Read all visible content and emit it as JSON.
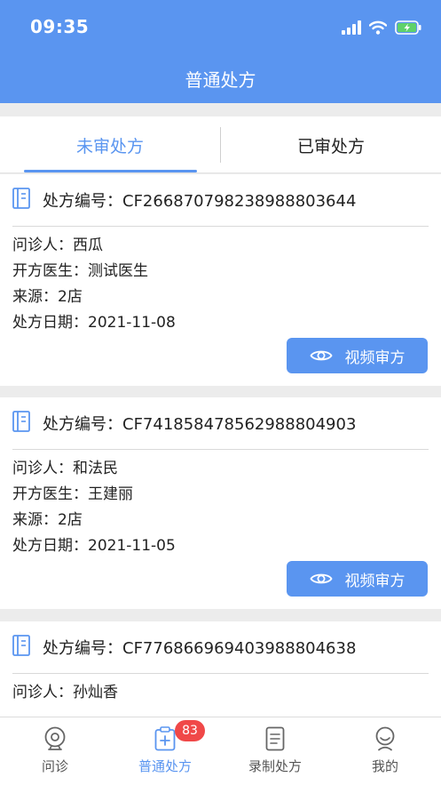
{
  "status_bar": {
    "time": "09:35"
  },
  "header": {
    "title": "普通处方"
  },
  "tabs": [
    {
      "label": "未审处方",
      "active": true
    },
    {
      "label": "已审处方",
      "active": false
    }
  ],
  "prescriptions": [
    {
      "number_label": "处方编号：CF266870798238988803644",
      "patient": "问诊人：西瓜",
      "doctor": "开方医生：测试医生",
      "source": "来源：2店",
      "date": "处方日期：2021-11-08",
      "button_label": "视频审方"
    },
    {
      "number_label": "处方编号：CF741858478562988804903",
      "patient": "问诊人：和法民",
      "doctor": "开方医生：王建丽",
      "source": "来源：2店",
      "date": "处方日期：2021-11-05",
      "button_label": "视频审方"
    },
    {
      "number_label": "处方编号：CF776866969403988804638",
      "patient": "问诊人：孙灿香"
    }
  ],
  "bottom_nav": [
    {
      "label": "问诊",
      "icon": "camera-icon"
    },
    {
      "label": "普通处方",
      "icon": "clipboard-plus-icon",
      "badge": "83",
      "active": true
    },
    {
      "label": "录制处方",
      "icon": "document-icon"
    },
    {
      "label": "我的",
      "icon": "profile-icon"
    }
  ],
  "colors": {
    "primary": "#5a95f0",
    "badge": "#f04848"
  }
}
